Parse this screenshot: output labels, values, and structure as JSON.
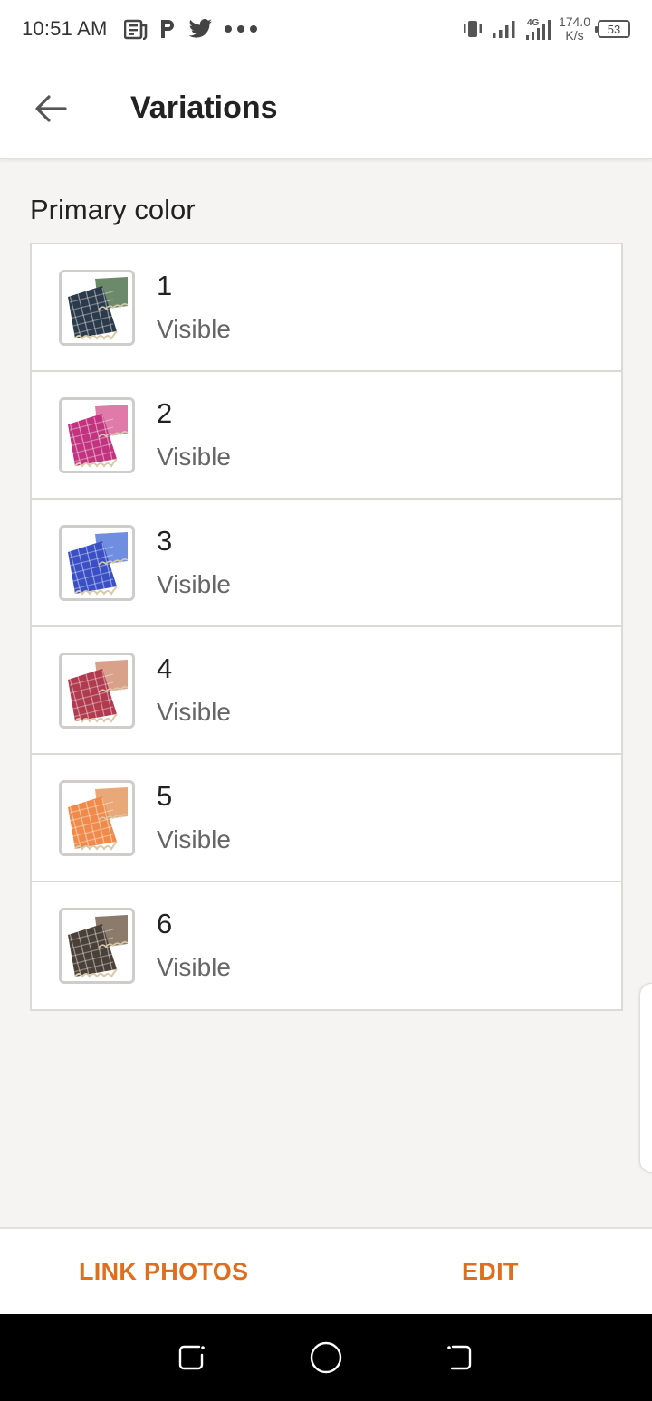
{
  "status_bar": {
    "time": "10:51 AM",
    "notification_icons": [
      "news-icon",
      "paypal-icon",
      "twitter-icon",
      "more-dots-icon"
    ],
    "network_type": "4G",
    "speed_value": "174.0",
    "speed_unit": "K/s",
    "battery": "53"
  },
  "app_bar": {
    "title": "Variations",
    "back_icon": "arrow-left-icon"
  },
  "section": {
    "label": "Primary color"
  },
  "variations": [
    {
      "name": "1",
      "status": "Visible",
      "swatch": "#2b3a4a",
      "swatch_alt": "#6c8a6a"
    },
    {
      "name": "2",
      "status": "Visible",
      "swatch": "#c2337f",
      "swatch_alt": "#e07aa8"
    },
    {
      "name": "3",
      "status": "Visible",
      "swatch": "#3a4fc4",
      "swatch_alt": "#6f8ee0"
    },
    {
      "name": "4",
      "status": "Visible",
      "swatch": "#b03a4e",
      "swatch_alt": "#d9a08a"
    },
    {
      "name": "5",
      "status": "Visible",
      "swatch": "#f08a4a",
      "swatch_alt": "#e8a878"
    },
    {
      "name": "6",
      "status": "Visible",
      "swatch": "#4a4038",
      "swatch_alt": "#8c7a6a"
    }
  ],
  "actions": {
    "link_photos": "LINK PHOTOS",
    "edit": "EDIT"
  },
  "colors": {
    "accent": "#e06f1d",
    "background": "#f5f4f2"
  }
}
